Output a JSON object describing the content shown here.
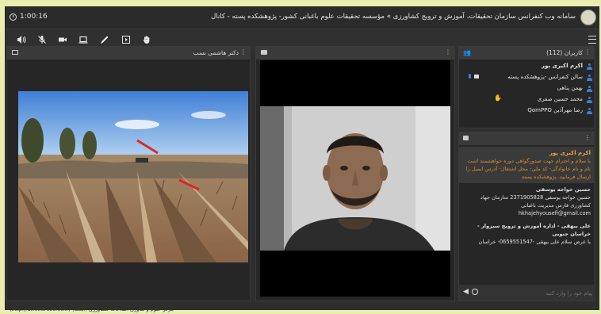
{
  "window": {
    "timer": "1:00:16",
    "title": "سامانه وب کنفرانس سازمان تحقیقات، آموزش و ترویج کشاورزی » مؤسسه تحقیقات علوم باغبانی کشور- پژوهشکده پسته - کانال"
  },
  "toolbar": {
    "icons": [
      "speaker-icon",
      "mic-muted-icon",
      "camera-icon",
      "screen-share-icon",
      "pen-icon",
      "play-icon",
      "hand-icon",
      "menu-icon"
    ]
  },
  "share_pod": {
    "title": "دکتر هاشمی نسب"
  },
  "attendees": {
    "title": "کاربران (112)",
    "rows": [
      {
        "name": "اکرم اکبری پور",
        "bold": true
      },
      {
        "name": "سالن کنفرانس -پژوهشکده پسته",
        "bold": false
      },
      {
        "name": "بهمن پناهی",
        "bold": false
      },
      {
        "name": "محمد حسین صفری",
        "bold": false
      },
      {
        "name": "رضا مهرآذین QomPPO",
        "bold": false
      }
    ]
  },
  "chat": {
    "messages": [
      {
        "author": "اکرم اکبری پور",
        "text": "با سلام و احترام جهت صدورگواهی دوره خواهشمند است نام و نام خانوادگی- کد ملی- محل اشتغال- آدرس ایمیل را ارسال فرمایید. پژوهشکده پسته"
      },
      {
        "author": "حسین خواجه یوسفی",
        "text": "حسین خواجه یوسفی 2371905828 سازمان جهاد کشاورزی فارس مدیریت باغبانی hkhajehyousefi@gmail.com"
      },
      {
        "author": "علی بیهقی - اداره آموزش و ترویج سبزوار - خراسان جنوبی",
        "text": "با عرض سلام علی بیهقی -0659551547- خراسان"
      }
    ],
    "input_placeholder": "پیام خود را وارد کنید"
  },
  "status_bar": {
    "text": "(http://acist.areeo.ac.ir) مرکز علوم و فناوری اطلاعات کشاورزی (آیکت)"
  },
  "colors": {
    "accent": "#e08a2c",
    "user_icon": "#3a7fd0",
    "background": "#e9edb0"
  }
}
